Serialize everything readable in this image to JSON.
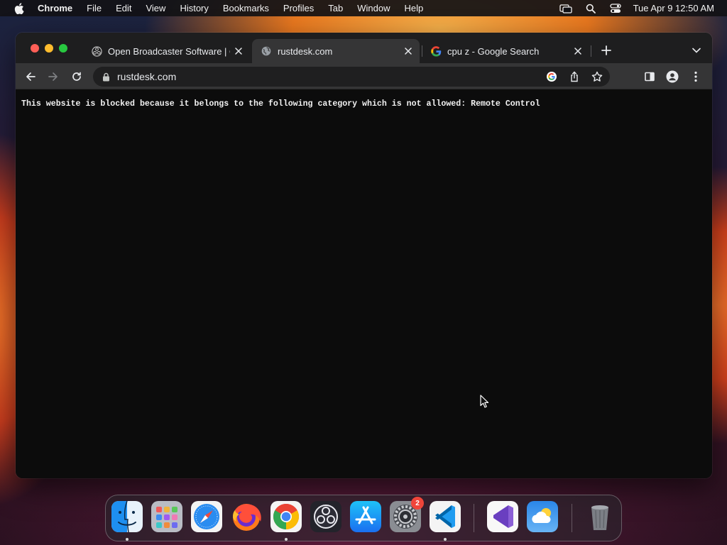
{
  "menubar": {
    "apple_icon": "apple-icon",
    "items": [
      "Chrome",
      "File",
      "Edit",
      "View",
      "History",
      "Bookmarks",
      "Profiles",
      "Tab",
      "Window",
      "Help"
    ],
    "status_icons": [
      "screen-mirroring-icon",
      "spotlight-search-icon",
      "control-center-icon"
    ],
    "clock": "Tue Apr 9  12:50 AM"
  },
  "browser": {
    "tabs": [
      {
        "title": "Open Broadcaster Software | O",
        "favicon": "obs-icon",
        "active": false
      },
      {
        "title": "rustdesk.com",
        "favicon": "globe-icon",
        "active": true
      },
      {
        "title": "cpu z - Google Search",
        "favicon": "google-icon",
        "active": false
      }
    ],
    "address": "rustdesk.com",
    "toolbar_icons": [
      "back-icon",
      "forward-icon",
      "reload-icon",
      "lock-icon",
      "google-lens-icon",
      "share-icon",
      "bookmark-star-icon",
      "side-panel-icon",
      "profile-icon",
      "menu-icon"
    ]
  },
  "page": {
    "message": "This website is blocked because it belongs to the following category which is not allowed: Remote Control"
  },
  "dock": {
    "apps": [
      "finder-icon",
      "launchpad-icon",
      "safari-icon",
      "firefox-icon",
      "chrome-icon",
      "obs-icon",
      "app-store-icon",
      "system-settings-icon",
      "vscode-icon",
      "visual-studio-icon",
      "weather-icon",
      "trash-icon"
    ],
    "settings_badge": "2",
    "colors": {
      "close": "#fe5f57",
      "minimize": "#febc2e",
      "maximize": "#28c840",
      "badge": "#f0453a"
    }
  }
}
